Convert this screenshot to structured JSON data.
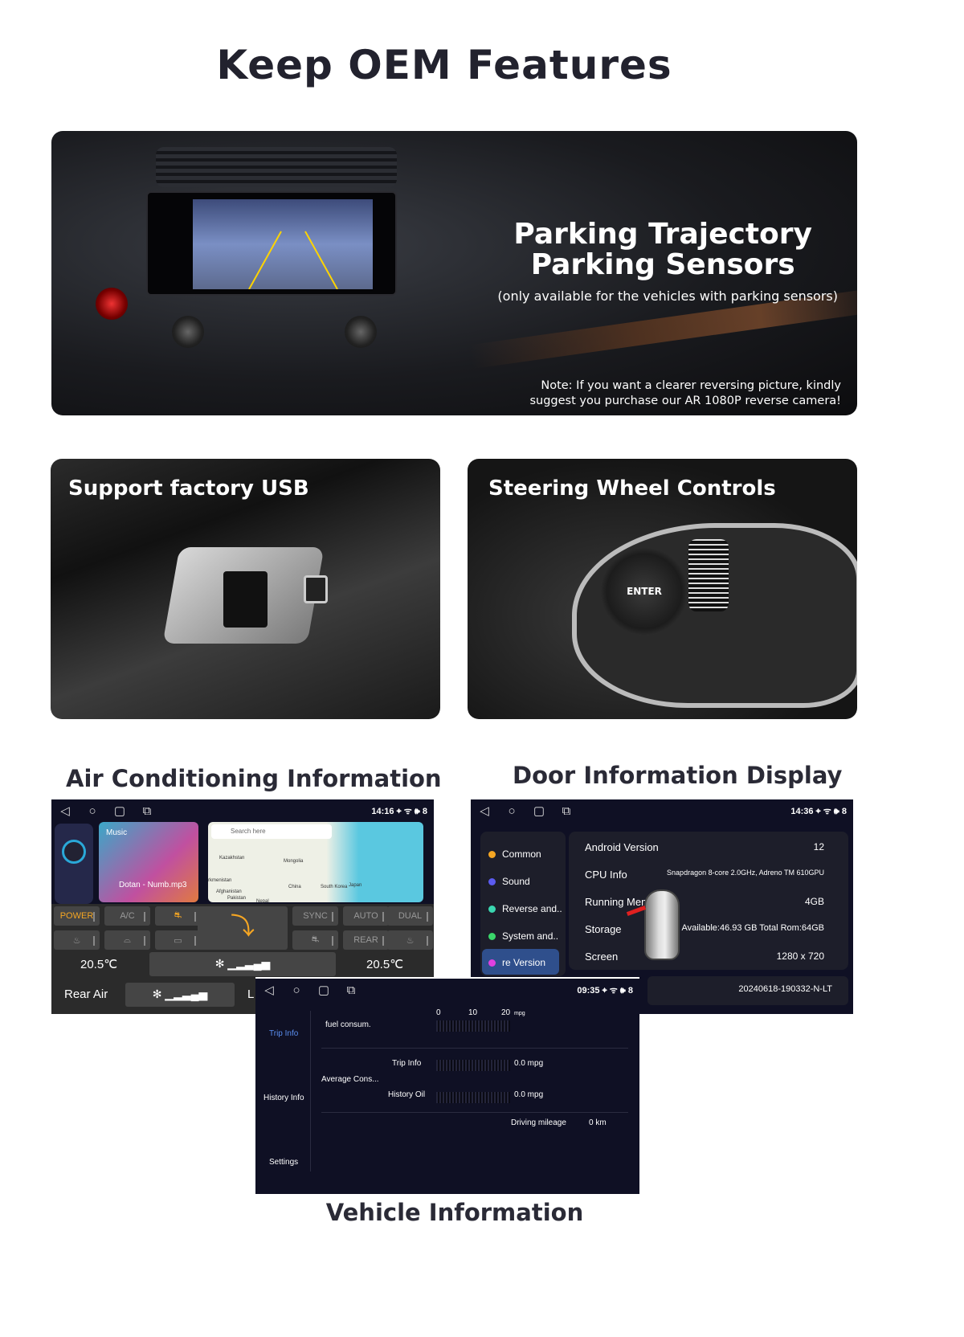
{
  "title": "Keep OEM Features",
  "hero": {
    "title1": "Parking Trajectory",
    "title2": "Parking Sensors",
    "subtitle": "(only available for the vehicles with parking sensors)",
    "note1": "Note: If you want a clearer reversing picture, kindly",
    "note2": "suggest you purchase our AR 1080P reverse camera!"
  },
  "usb": {
    "title": "Support factory USB"
  },
  "steering": {
    "title": "Steering Wheel Controls",
    "enter": "ENTER"
  },
  "ac": {
    "heading": "Air Conditioning Information",
    "time": "14:16",
    "battery": "8",
    "music_label": "Music",
    "track": "Dotan - Numb.mp3",
    "search_placeholder": "Search here",
    "map_labels": [
      "Kazakhstan",
      "Mongolia",
      "China",
      "South Korea",
      "Japan",
      "Afghanistan",
      "Pakistan",
      "Nepal",
      "rkmenistan"
    ],
    "buttons": {
      "power": "POWER",
      "ac": "A/C",
      "sync": "SYNC",
      "auto": "AUTO",
      "dual": "DUAL",
      "rear": "REAR"
    },
    "temp_left": "20.5℃",
    "temp_right": "20.5℃",
    "rear_air": "Rear Air",
    "rear_extra": "L",
    "accent": "#f5a623"
  },
  "door": {
    "heading": "Door Information Display",
    "time": "14:36",
    "battery": "8",
    "menu": [
      {
        "label": "Common",
        "color": "#f5a623"
      },
      {
        "label": "Sound",
        "color": "#5b5bf0"
      },
      {
        "label": "Reverse and..",
        "color": "#3ad6b0"
      },
      {
        "label": "System and..",
        "color": "#3ad66a"
      },
      {
        "label": "re Version",
        "color": "#e040e0"
      }
    ],
    "rows": [
      {
        "k": "Android Version",
        "v": "12"
      },
      {
        "k": "CPU Info",
        "v": "Snapdragon 8-core 2.0GHz, Adreno TM 610GPU"
      },
      {
        "k": "Running Mem",
        "v": "4GB"
      },
      {
        "k": "Storage",
        "v": "Available:46.93 GB Total Rom:64GB"
      },
      {
        "k": "Screen",
        "v": "1280 x 720"
      }
    ],
    "build": "20240618-190332-N-LT"
  },
  "vehicle": {
    "heading": "Vehicle Information",
    "time": "09:35",
    "battery": "8",
    "side": [
      "Trip Info",
      "History Info",
      "Settings"
    ],
    "fuel_label": "fuel consum.",
    "scale": [
      "0",
      "10",
      "20"
    ],
    "unit": "mpg",
    "avg_label": "Average Cons...",
    "trip_label": "Trip Info",
    "trip_value": "0.0 mpg",
    "history_label": "History Oil",
    "history_value": "0.0 mpg",
    "mileage_label": "Driving mileage",
    "mileage_value": "0 km"
  }
}
